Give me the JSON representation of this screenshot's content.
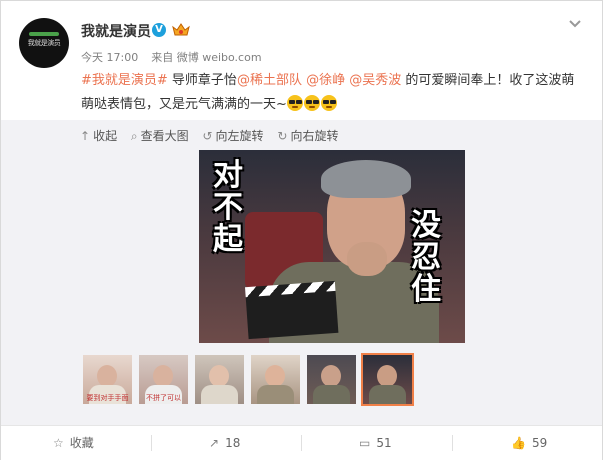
{
  "post": {
    "username": "我就是演员",
    "vip_icon_name": "vip-crown-icon",
    "avatar_text": "我就是演员",
    "meta": {
      "time": "今天 17:00",
      "source_prefix": "来自",
      "source": "微博 weibo.com"
    },
    "text": {
      "hashtag": "#我就是演员#",
      "t1": " 导师章子怡",
      "m1": "@稀土部队",
      "t2": " ",
      "m2": "@徐峥",
      "t3": " ",
      "m3": "@吴秀波",
      "t4": " 的可爱瞬间奉上！收了这波萌萌哒表情包，又是元气满满的一天~"
    },
    "emoji_count": 3
  },
  "toolbar": {
    "collapse": "收起",
    "view_large": "查看大图",
    "rotate_left": "向左旋转",
    "rotate_right": "向右旋转"
  },
  "image_captions": {
    "left": "对不起",
    "right": "没忍住"
  },
  "thumbnails": [
    {
      "index": 1,
      "caption": "要到对手手面"
    },
    {
      "index": 2,
      "caption": "不拼了可以"
    },
    {
      "index": 3,
      "caption": ""
    },
    {
      "index": 4,
      "caption": ""
    },
    {
      "index": 5,
      "caption": ""
    },
    {
      "index": 6,
      "caption": "",
      "selected": true
    }
  ],
  "actions": {
    "favorite": "收藏",
    "repost": "18",
    "comment": "51",
    "like": "59"
  },
  "colors": {
    "link": "#eb7350",
    "verified": "#1ea0dc",
    "selected_border": "#f08048"
  }
}
